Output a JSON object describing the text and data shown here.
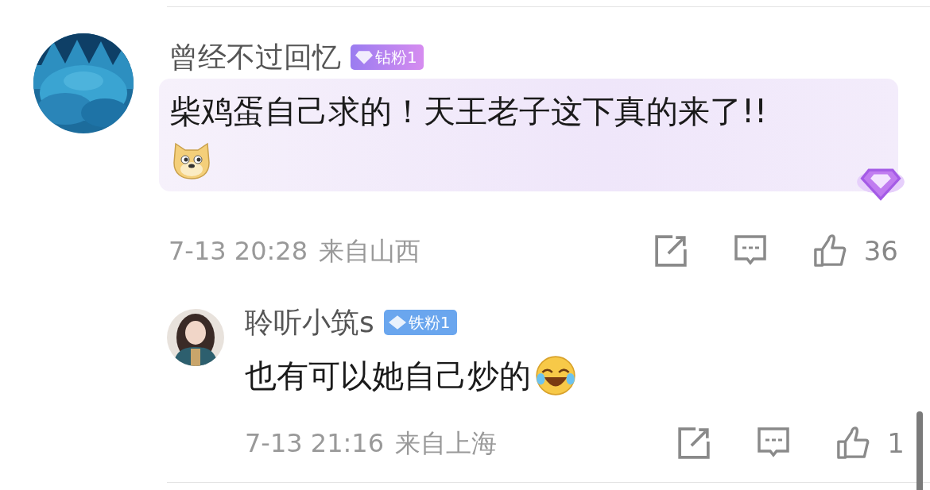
{
  "comment": {
    "author": "曾经不过回忆",
    "badge": {
      "kind": "diamond",
      "label": "钻粉1"
    },
    "text": "柴鸡蛋自己求的！天王老子这下真的来了!!",
    "emoji": {
      "kind": "doge"
    },
    "highlighted": true,
    "time": "7-13 20:28",
    "location": "来自山西",
    "likes": "36"
  },
  "reply": {
    "author": "聆听小筑s",
    "badge": {
      "kind": "iron",
      "label": "铁粉1"
    },
    "text": "也有可以她自己炒的",
    "emoji": {
      "kind": "laugh"
    },
    "time": "7-13 21:16",
    "location": "来自上海",
    "likes": "1"
  }
}
